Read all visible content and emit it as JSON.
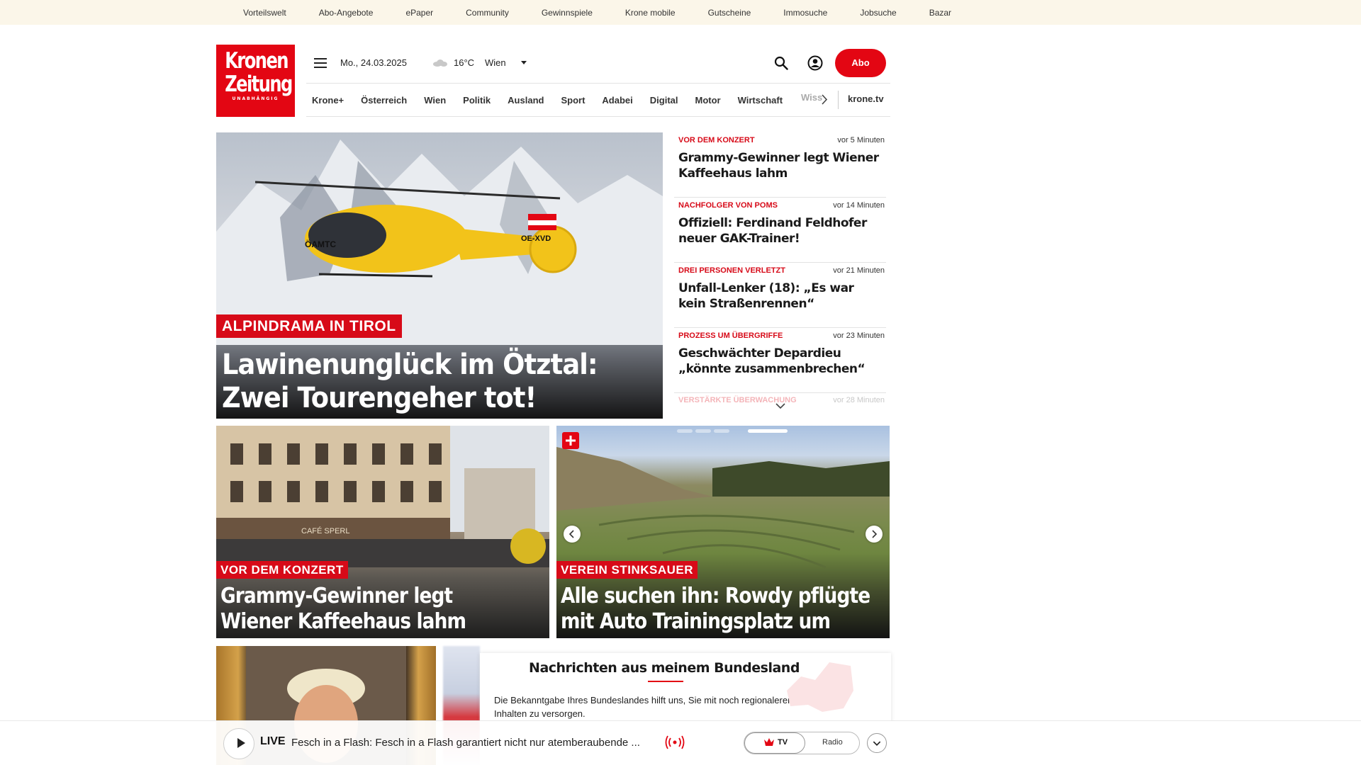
{
  "top_links": [
    "Vorteilswelt",
    "Abo-Angebote",
    "ePaper",
    "Community",
    "Gewinnspiele",
    "Krone mobile",
    "Gutscheine",
    "Immosuche",
    "Jobsuche",
    "Bazar"
  ],
  "logo": {
    "line1": "Kronen",
    "line2": "Zeitung",
    "tagline": "UNABHÄNGIG"
  },
  "header": {
    "date": "Mo., 24.03.2025",
    "temperature": "16°C",
    "city": "Wien",
    "abo_label": "Abo"
  },
  "nav": {
    "items": [
      "Krone+",
      "Österreich",
      "Wien",
      "Politik",
      "Ausland",
      "Sport",
      "Adabei",
      "Digital",
      "Motor",
      "Wirtschaft"
    ],
    "cut_item": "Wiss",
    "krone_tv": "krone.tv"
  },
  "hero": {
    "kicker": "ALPINDRAMA IN TIROL",
    "headline_line1": "Lawinenunglück im Ötztal:",
    "headline_line2": "Zwei Tourengeher tot!",
    "helicopter_text_1": "ÖAMTC",
    "helicopter_text_2": "OE-XVD"
  },
  "side_news": [
    {
      "kicker": "VOR DEM KONZERT",
      "time": "vor 5 Minuten",
      "headline": "Grammy-Gewinner legt Wiener Kaffeehaus lahm"
    },
    {
      "kicker": "NACHFOLGER VON POMS",
      "time": "vor 14 Minuten",
      "headline": "Offiziell: Ferdinand Feldhofer neuer GAK-Trainer!"
    },
    {
      "kicker": "DREI PERSONEN VERLETZT",
      "time": "vor 21 Minuten",
      "headline": "Unfall-Lenker (18): „Es war kein Straßenrennen“"
    },
    {
      "kicker": "PROZESS UM ÜBERGRIFFE",
      "time": "vor 23 Minuten",
      "headline": "Geschwächter Depardieu „könnte zusammenbrechen“"
    }
  ],
  "side_fade": {
    "kicker": "VERSTÄRKTE ÜBERWACHUNG",
    "time": "vor 28 Minuten"
  },
  "cards": [
    {
      "kicker": "VOR DEM KONZERT",
      "line1": "Grammy-Gewinner legt",
      "line2": "Wiener Kaffeehaus lahm",
      "sign": "CAFÉ SPERL"
    },
    {
      "kicker": "VEREIN STINKSAUER",
      "line1": "Alle suchen ihn: Rowdy pflügte",
      "line2": "mit Auto Trainingsplatz um"
    }
  ],
  "popup": {
    "title": "Nachrichten aus meinem Bundesland",
    "text": "Die Bekanntgabe Ihres Bundeslandes hilft uns, Sie mit noch regionaleren Inhalten zu versorgen."
  },
  "player": {
    "live_label": "LIVE",
    "title": "Fesch in a Flash: Fesch in a Flash garantiert nicht nur atemberaubende ...",
    "tv_label": "TV",
    "radio_label": "Radio"
  },
  "colors": {
    "brand_red": "#e30613",
    "kicker_red": "#d70a18",
    "topbar_bg": "#fbf6e9"
  }
}
